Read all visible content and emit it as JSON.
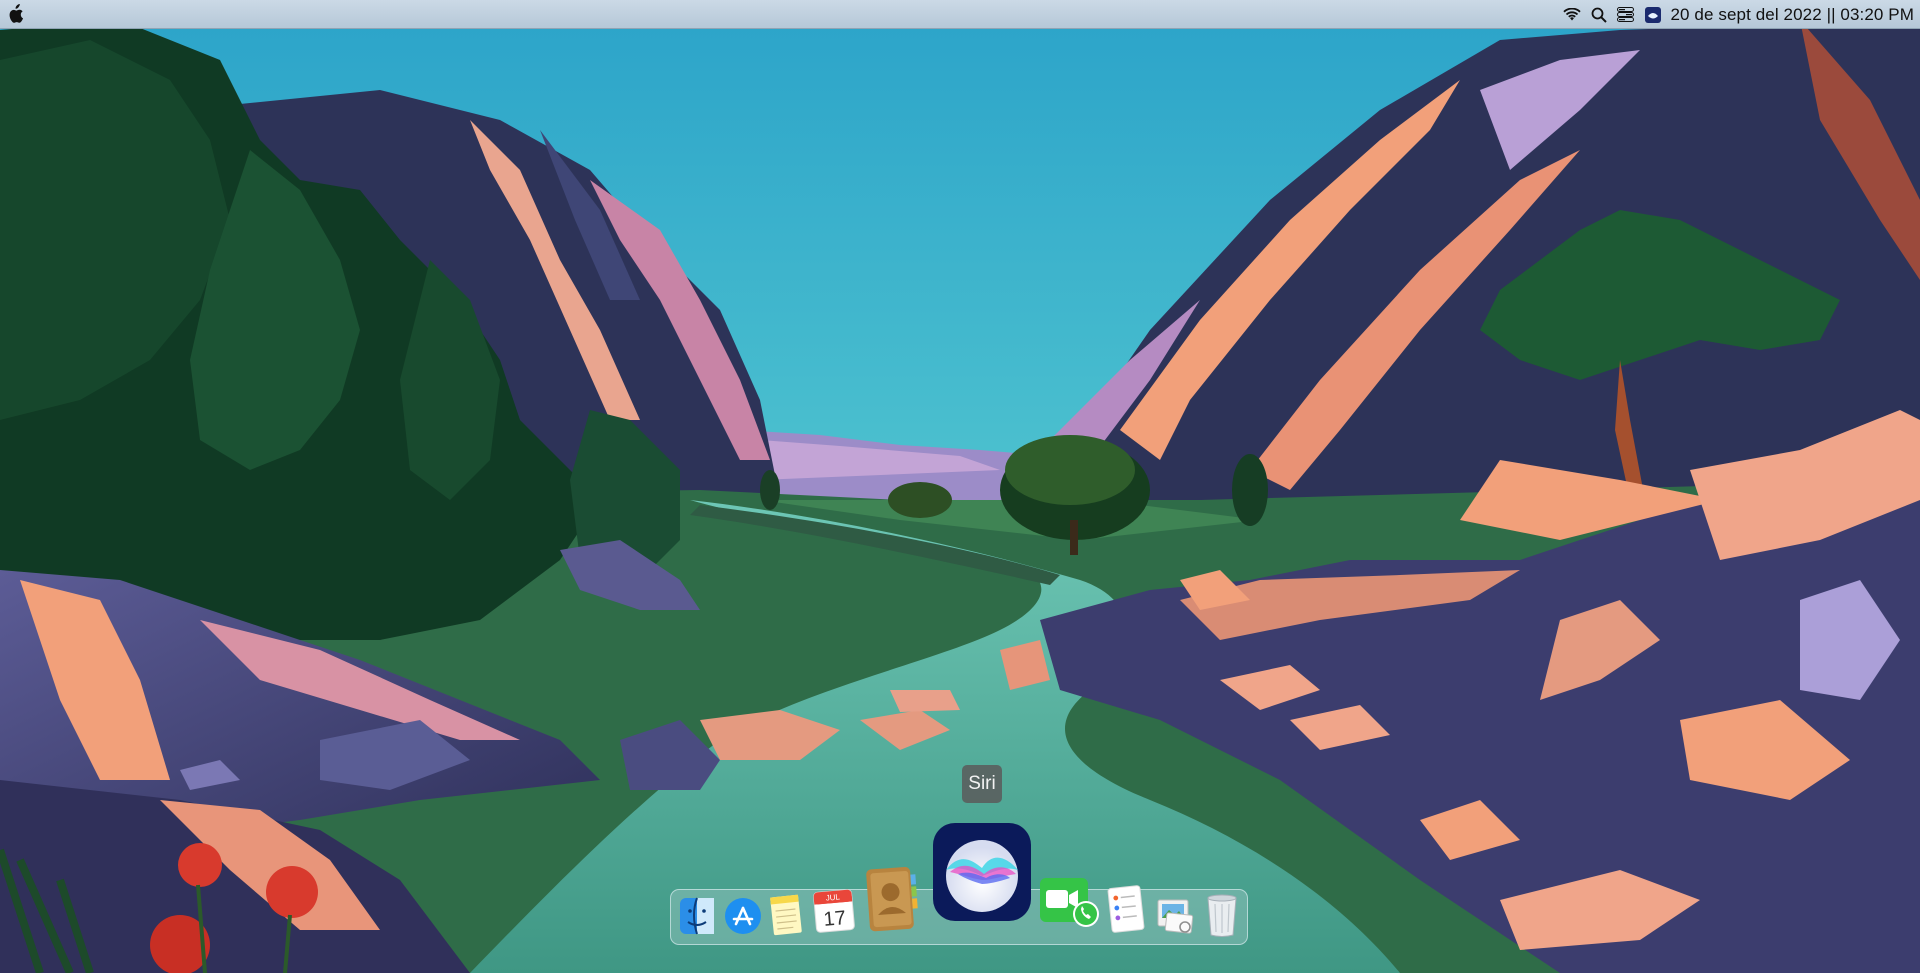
{
  "menubar": {
    "apple_icon": "apple-logo-icon",
    "status_icons": [
      "wifi-icon",
      "search-icon",
      "control-center-icon",
      "siri-status-icon"
    ],
    "clock": "20 de sept del 2022 || 03:20 PM"
  },
  "tooltip": {
    "label": "Siri"
  },
  "dock": {
    "items": [
      {
        "name": "Finder",
        "icon": "finder-icon"
      },
      {
        "name": "App Store",
        "icon": "app-store-icon"
      },
      {
        "name": "Notes",
        "icon": "notes-icon"
      },
      {
        "name": "Calendar",
        "icon": "calendar-icon",
        "month": "JUL",
        "day": "17"
      },
      {
        "name": "Contacts",
        "icon": "contacts-icon"
      },
      {
        "name": "Siri",
        "icon": "siri-icon"
      },
      {
        "name": "FaceTime",
        "icon": "facetime-icon"
      },
      {
        "name": "Reminders",
        "icon": "reminders-icon"
      },
      {
        "name": "Preview",
        "icon": "preview-icon"
      },
      {
        "name": "Trash",
        "icon": "trash-icon"
      }
    ]
  },
  "colors": {
    "menubar": "#c3d3e2",
    "sky_top": "#2ba3c9",
    "sky_bottom": "#6fe0d5",
    "river": "#4aa289",
    "cliff_dark": "#2b2f52",
    "cliff_light": "#f0a080"
  }
}
